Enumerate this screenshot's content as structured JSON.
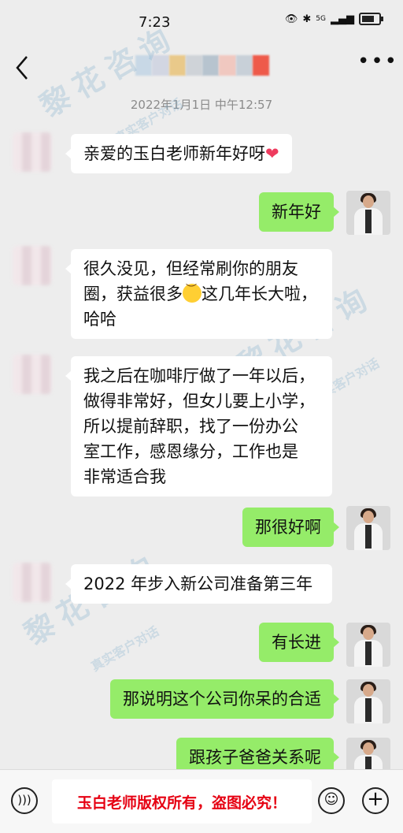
{
  "status": {
    "time": "7:23",
    "signal": "5G"
  },
  "header": {
    "title_colors": [
      "#c8d8e6",
      "#d2d6e2",
      "#e9c98a",
      "#cfd3d8",
      "#b7c4cf",
      "#f0c8c0",
      "#c8d0d8",
      "#ee5a4a"
    ]
  },
  "timestamp": "2022年1月1日 中午12:57",
  "messages": [
    {
      "from": "other",
      "text": "亲爱的玉白老师新年好呀",
      "emoji": "heart-icon"
    },
    {
      "from": "self",
      "text": "新年好"
    },
    {
      "from": "other",
      "line1": "很久没见，但经常刷你的朋友",
      "line2a": "圈，获益很多",
      "line2b": "这几年长大啦，",
      "line3": "哈哈",
      "emoji": "smile-icon"
    },
    {
      "from": "other",
      "lines": [
        "我之后在咖啡厅做了一年以后，",
        "做得非常好，但女儿要上小学，",
        "所以提前辞职，找了一份办公",
        "室工作，感恩缘分，工作也是",
        "非常适合我"
      ]
    },
    {
      "from": "self",
      "text": "那很好啊"
    },
    {
      "from": "other",
      "text": "2022 年步入新公司准备第三年"
    },
    {
      "from": "self",
      "text": "有长进"
    },
    {
      "from": "self",
      "text": "那说明这个公司你呆的合适"
    },
    {
      "from": "self",
      "text": "跟孩子爸爸关系呢"
    }
  ],
  "watermark": {
    "big": "黎花咨询",
    "small": "真实客户对话"
  },
  "input": {
    "text": "玉白老师版权所有，盗图必究！",
    "color": "#e60012"
  },
  "colors": {
    "self_bubble": "#95ec69",
    "other_bubble": "#ffffff",
    "background": "#ededed"
  }
}
